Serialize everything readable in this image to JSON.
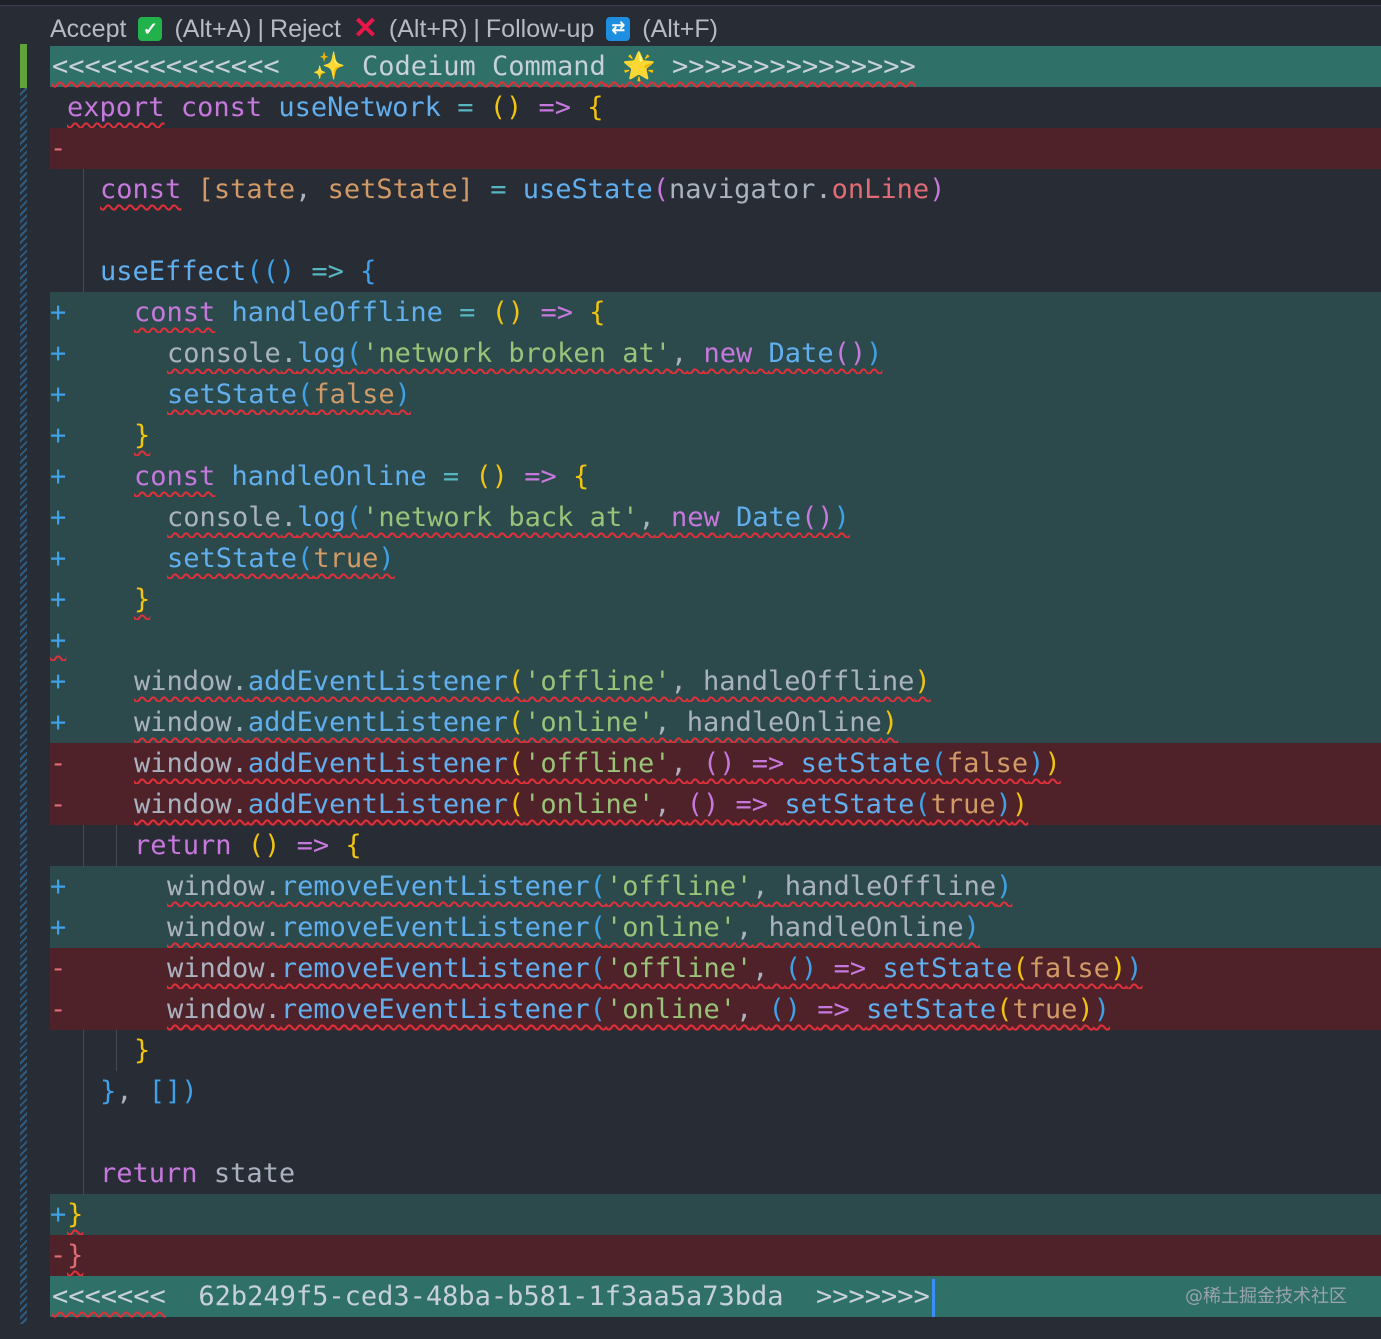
{
  "codelens": {
    "accept": "Accept",
    "accept_shortcut": "(Alt+A)",
    "sep1": "|",
    "reject": "Reject",
    "reject_shortcut": "(Alt+R)",
    "sep2": "|",
    "followup": "Follow-up",
    "followup_shortcut": "(Alt+F)"
  },
  "banner_top": {
    "left_arrows": "<<<<<<<<<<<<<<",
    "sparkle": "✨",
    "title": "Codeium Command",
    "sun": "🌟",
    "right_arrows": ">>>>>>>>>>>>>>>"
  },
  "banner_bottom": {
    "left_arrows": "<<<<<<<",
    "id": "62b249f5-ced3-48ba-b581-1f3aa5a73bda",
    "right_arrows": ">>>>>>>"
  },
  "watermark": "@稀土掘金技术社区",
  "code": {
    "l1": {
      "kw": "export",
      "kw2": "const",
      "name": "useNetwork",
      "eq": "=",
      "par": "()",
      "arrow": "=>",
      "brace": "{"
    },
    "l2": {
      "sign": "-"
    },
    "l3": {
      "kw": "const",
      "open": "[",
      "a": "state",
      "comma": ",",
      "b": "setState",
      "close": "]",
      "eq": "=",
      "fn": "useState",
      "po": "(",
      "obj": "navigator",
      "dot": ".",
      "prop": "onLine",
      "pc": ")"
    },
    "l5": {
      "fn": "useEffect",
      "po": "(",
      "par": "()",
      "arrow": "=>",
      "brace": "{"
    },
    "a1": {
      "sign": "+",
      "kw": "const",
      "name": "handleOffline",
      "eq": "=",
      "par": "()",
      "arrow": "=>",
      "brace": "{"
    },
    "a2": {
      "sign": "+",
      "obj": "console",
      "dot": ".",
      "fn": "log",
      "po": "(",
      "str": "'network broken at'",
      "comma": ",",
      "kw": "new",
      "cls": "Date",
      "call": "()",
      "pc": ")"
    },
    "a3": {
      "sign": "+",
      "fn": "setState",
      "po": "(",
      "val": "false",
      "pc": ")"
    },
    "a4": {
      "sign": "+",
      "brace": "}"
    },
    "a5": {
      "sign": "+",
      "kw": "const",
      "name": "handleOnline",
      "eq": "=",
      "par": "()",
      "arrow": "=>",
      "brace": "{"
    },
    "a6": {
      "sign": "+",
      "obj": "console",
      "dot": ".",
      "fn": "log",
      "po": "(",
      "str": "'network back at'",
      "comma": ",",
      "kw": "new",
      "cls": "Date",
      "call": "()",
      "pc": ")"
    },
    "a7": {
      "sign": "+",
      "fn": "setState",
      "po": "(",
      "val": "true",
      "pc": ")"
    },
    "a8": {
      "sign": "+",
      "brace": "}"
    },
    "a9": {
      "sign": "+"
    },
    "a10": {
      "sign": "+",
      "obj": "window",
      "dot": ".",
      "fn": "addEventListener",
      "po": "(",
      "str": "'offline'",
      "comma": ",",
      "arg": "handleOffline",
      "pc": ")"
    },
    "a11": {
      "sign": "+",
      "obj": "window",
      "dot": ".",
      "fn": "addEventListener",
      "po": "(",
      "str": "'online'",
      "comma": ",",
      "arg": "handleOnline",
      "pc": ")"
    },
    "d1": {
      "sign": "-",
      "obj": "window",
      "dot": ".",
      "fn": "addEventListener",
      "po": "(",
      "str": "'offline'",
      "comma": ",",
      "par": "()",
      "arrow": "=>",
      "fn2": "setState",
      "po2": "(",
      "val": "false",
      "pc2": ")",
      "pc": ")"
    },
    "d2": {
      "sign": "-",
      "obj": "window",
      "dot": ".",
      "fn": "addEventListener",
      "po": "(",
      "str": "'online'",
      "comma": ",",
      "par": "()",
      "arrow": "=>",
      "fn2": "setState",
      "po2": "(",
      "val": "true",
      "pc2": ")",
      "pc": ")"
    },
    "r1": {
      "kw": "return",
      "par": "()",
      "arrow": "=>",
      "brace": "{"
    },
    "a12": {
      "sign": "+",
      "obj": "window",
      "dot": ".",
      "fn": "removeEventListener",
      "po": "(",
      "str": "'offline'",
      "comma": ",",
      "arg": "handleOffline",
      "pc": ")"
    },
    "a13": {
      "sign": "+",
      "obj": "window",
      "dot": ".",
      "fn": "removeEventListener",
      "po": "(",
      "str": "'online'",
      "comma": ",",
      "arg": "handleOnline",
      "pc": ")"
    },
    "d3": {
      "sign": "-",
      "obj": "window",
      "dot": ".",
      "fn": "removeEventListener",
      "po": "(",
      "str": "'offline'",
      "comma": ",",
      "par": "()",
      "arrow": "=>",
      "fn2": "setState",
      "po2": "(",
      "val": "false",
      "pc2": ")",
      "pc": ")"
    },
    "d4": {
      "sign": "-",
      "obj": "window",
      "dot": ".",
      "fn": "removeEventListener",
      "po": "(",
      "str": "'online'",
      "comma": ",",
      "par": "()",
      "arrow": "=>",
      "fn2": "setState",
      "po2": "(",
      "val": "true",
      "pc2": ")",
      "pc": ")"
    },
    "c1": {
      "brace": "}"
    },
    "c2": {
      "brace": "}",
      "comma": ",",
      "arr": "[]",
      "pc": ")"
    },
    "ret": {
      "kw": "return",
      "name": "state"
    },
    "end_add": {
      "sign": "+",
      "brace": "}"
    },
    "end_del": {
      "sign": "-",
      "brace": "}"
    }
  },
  "colors": {
    "banner": "#2f7068",
    "added": "#2c4a4b",
    "removed": "#4e2228",
    "background": "#282c34"
  }
}
